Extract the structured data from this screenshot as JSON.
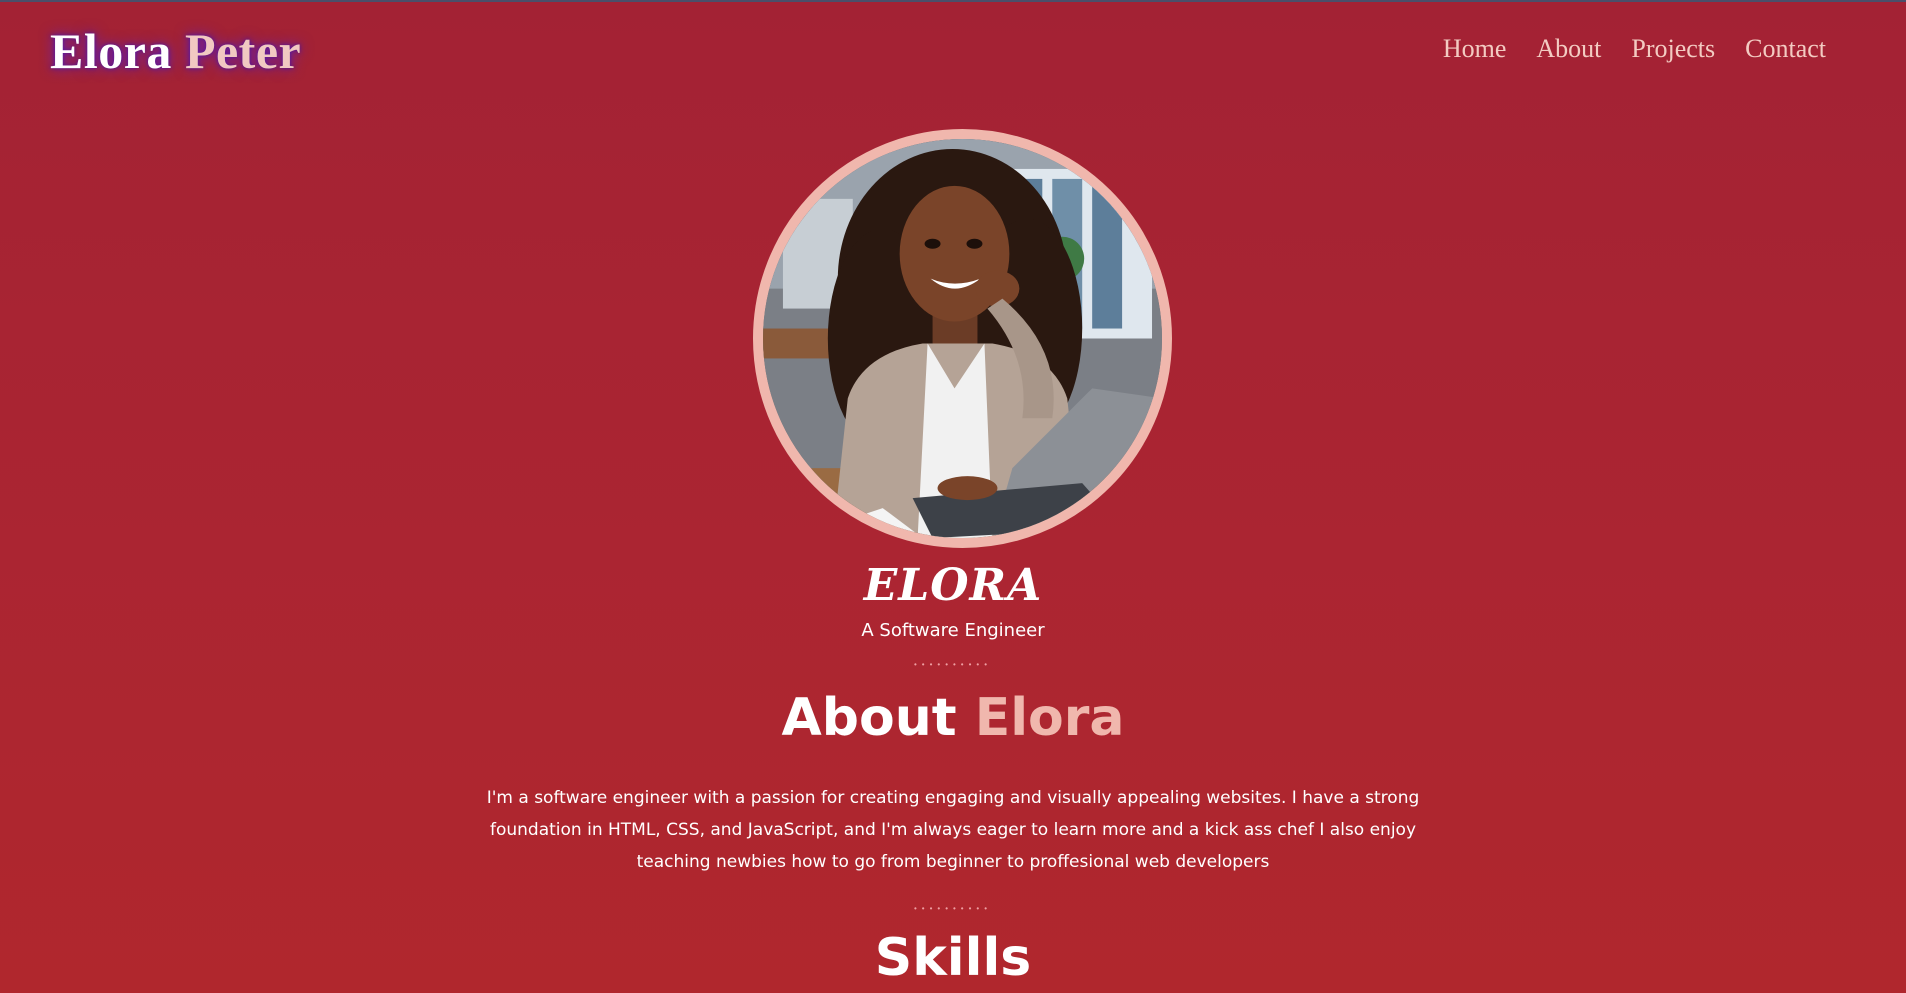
{
  "header": {
    "logo_first": "Elora",
    "logo_last": "Peter",
    "nav": [
      "Home",
      "About",
      "Projects",
      "Contact"
    ]
  },
  "hero": {
    "image_subject": "portrait of smiling woman at laptop",
    "name": "ELORA",
    "role": "A Software Engineer"
  },
  "about": {
    "title_plain": "About",
    "title_accent": "Elora",
    "text": "I'm a software engineer with a passion for creating engaging and visually appealing websites. I have a strong foundation in HTML, CSS, and JavaScript, and I'm always eager to learn more and a kick ass chef I also enjoy teaching newbies how to go from beginner to proffesional web developers"
  },
  "skills": {
    "title": "Skills"
  },
  "divider": "••••••••••",
  "colors": {
    "background_top": "#a32234",
    "background_bottom": "#b0272d",
    "accent": "#f0b7ad",
    "nav_text": "#f3cbc2",
    "logo_glow": "#5a1ec8"
  }
}
